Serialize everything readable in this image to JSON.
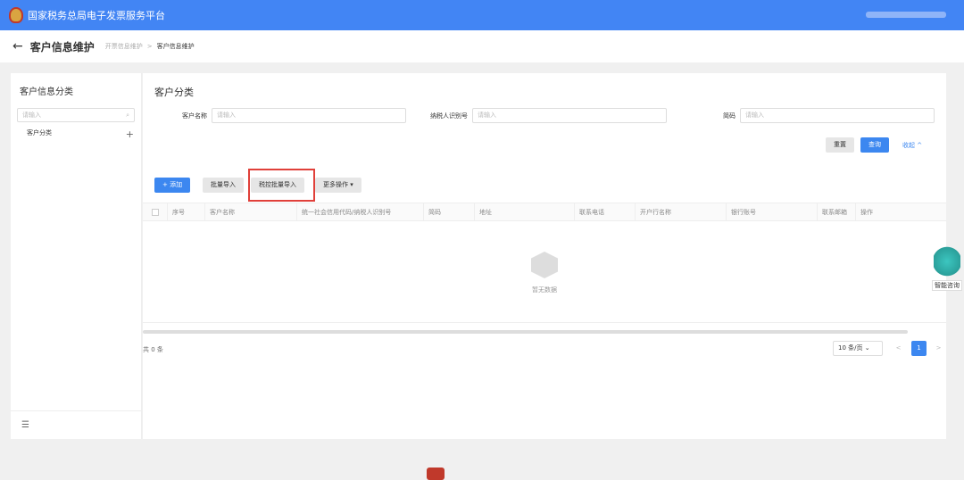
{
  "header": {
    "title": "国家税务总局电子发票服务平台"
  },
  "subheader": {
    "back": "←",
    "page_title": "客户信息维护",
    "breadcrumb": [
      "开票信息维护",
      "客户信息维护"
    ],
    "sep": ">"
  },
  "sidebar": {
    "title": "客户信息分类",
    "search_placeholder": "请输入",
    "tree": [
      {
        "label": "客户分类"
      }
    ],
    "add": "+",
    "collapse_icon": "☰"
  },
  "main": {
    "title": "客户分类",
    "filters": [
      {
        "label": "客户名称",
        "placeholder": "请输入"
      },
      {
        "label": "纳税人识别号",
        "placeholder": "请输入"
      },
      {
        "label": "简码",
        "placeholder": "请输入"
      }
    ],
    "reset": "重置",
    "query": "查询",
    "collapse": "收起 ^",
    "actions": {
      "add": "+ 添加",
      "batch_import": "批量导入",
      "tax_batch_import": "税控批量导入",
      "more": "更多操作 ▾"
    },
    "columns": [
      "序号",
      "客户名称",
      "统一社会信用代码/纳税人识别号",
      "简码",
      "地址",
      "联系电话",
      "开户行名称",
      "银行账号",
      "联系邮箱",
      "操作"
    ],
    "empty": "暂无数据",
    "total": "共 0 条",
    "page_size": "10 条/页 ⌄",
    "prev": "<",
    "next": ">",
    "current_page": "1"
  },
  "assistant": {
    "label": "智能咨询"
  }
}
